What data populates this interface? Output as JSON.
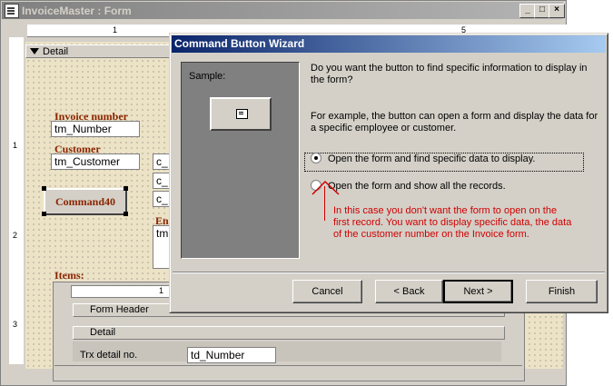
{
  "background_window": {
    "title": "InvoiceMaster : Form",
    "detail_section": "Detail",
    "ruler_numbers": [
      "1",
      "5"
    ],
    "left_ruler_numbers": [
      "1",
      "2",
      "3"
    ],
    "fields": {
      "invoice_label": "Invoice number",
      "invoice_field": "tm_Number",
      "customer_label": "Customer",
      "customer_field": "tm_Customer",
      "command_button": "Command40",
      "partial_fields": [
        "c_",
        "c_",
        "c_"
      ],
      "partial_label": "En",
      "partial_text": "tm",
      "items_label": "Items:"
    },
    "subform": {
      "ruler_number": "1",
      "form_header": "Form Header",
      "detail": "Detail",
      "row_label": "Trx detail no.",
      "row_field": "td_Number"
    }
  },
  "wizard": {
    "title": "Command Button Wizard",
    "sample_label": "Sample:",
    "question": "Do you want the button to find specific information to display in the form?",
    "example": "For example, the button can open a form and display the data for a specific employee or customer.",
    "options": [
      {
        "label": "Open the form and find specific data to display.",
        "selected": true
      },
      {
        "label": "Open the form and show all the records.",
        "selected": false
      }
    ],
    "annotation": "In this case you don't want the form to open on the first record. You want to display specific data, the data of the customer number on the Invoice form.",
    "annotation_color": "#d00000",
    "buttons": {
      "cancel": "Cancel",
      "back": "< Back",
      "next": "Next >",
      "finish": "Finish"
    }
  },
  "colors": {
    "title_active": "#0a246a",
    "title_inactive": "#808080",
    "design_grid": "#ece2c6",
    "label_text": "#8b2500"
  }
}
